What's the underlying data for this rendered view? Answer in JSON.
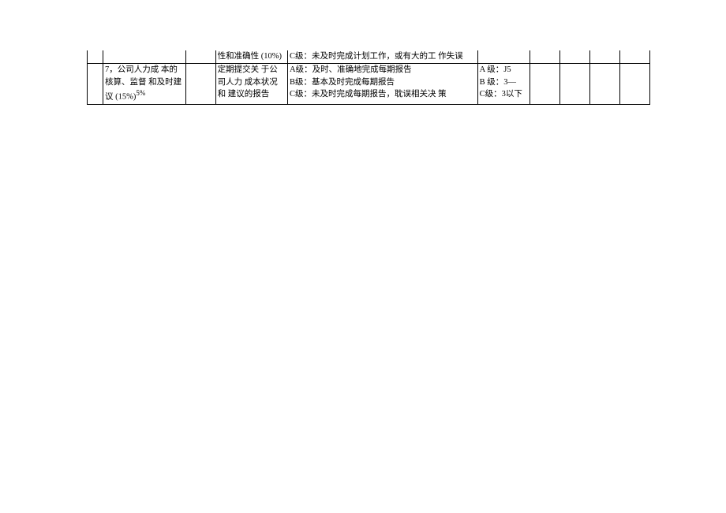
{
  "row1": {
    "col3": "性和准确性 (10%)",
    "col4": "C级：未及时完成计划工作，或有大的工 作失误"
  },
  "row2": {
    "col1": "7，公司人力成 本的核算、监督 和及时建议 (15%)",
    "col2": "5%",
    "col3": "定期提交关 于公司人力 成本状况和 建议的报告",
    "col4": "A级：及时、准确地完成每期报告\nB级：基本及时完成每期报告\nC级：未及时完成每期报告，耽误相关决 策",
    "col5": "A 级：J5\nB 级：3—\nC级：3以下"
  }
}
